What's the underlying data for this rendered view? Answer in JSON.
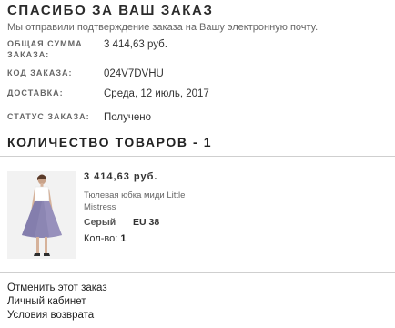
{
  "page": {
    "title": "СПАСИБО ЗА ВАШ ЗАКАЗ",
    "subtitle": "Мы отправили подтверждение заказа на Вашу электронную почту."
  },
  "summary": {
    "total_label": "ОБЩАЯ СУММА ЗАКАЗА:",
    "total_value": "3 414,63 руб.",
    "order_code_label": "КОД ЗАКАЗА:",
    "order_code_value": "024V7DVHU",
    "delivery_label": "ДОСТАВКА:",
    "delivery_value": "Среда, 12 июль, 2017",
    "status_label": "СТАТУС ЗАКАЗА:",
    "status_value": "Получено"
  },
  "items_section": {
    "heading": "КОЛИЧЕСТВО ТОВАРОВ - 1"
  },
  "product": {
    "price": "3 414,63 руб.",
    "name": "Тюлевая юбка миди Little Mistress",
    "color": "Серый",
    "size": "EU 38",
    "qty_label": "Кол-во:",
    "qty_value": "1",
    "image_icon": "product-photo-skirt"
  },
  "links": {
    "cancel": "Отменить этот заказ",
    "account": "Личный кабинет",
    "returns": "Условия возврата"
  }
}
